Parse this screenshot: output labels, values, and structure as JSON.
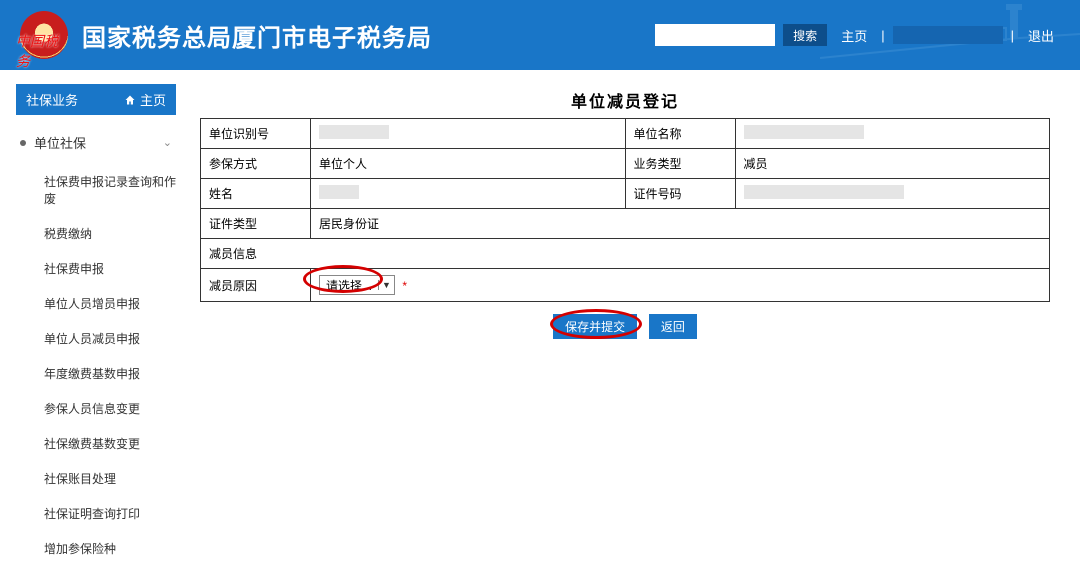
{
  "header": {
    "title": "国家税务总局厦门市电子税务局",
    "search_placeholder": "",
    "search_btn": "搜索",
    "home": "主页",
    "logout": "退出"
  },
  "sidebar": {
    "head": "社保业务",
    "home_label": "主页",
    "group": "单位社保",
    "items": [
      "社保费申报记录查询和作废",
      "税费缴纳",
      "社保费申报",
      "单位人员增员申报",
      "单位人员减员申报",
      "年度缴费基数申报",
      "参保人员信息变更",
      "社保缴费基数变更",
      "社保账目处理",
      "社保证明查询打印",
      "增加参保险种"
    ]
  },
  "form": {
    "title": "单位减员登记",
    "labels": {
      "unit_id": "单位识别号",
      "unit_name": "单位名称",
      "mode": "参保方式",
      "biz_type": "业务类型",
      "name": "姓名",
      "cert_no": "证件号码",
      "cert_type": "证件类型",
      "section": "减员信息",
      "reason": "减员原因"
    },
    "values": {
      "mode": "单位个人",
      "biz_type": "减员",
      "cert_type": "居民身份证",
      "reason_select": "请选择..."
    }
  },
  "buttons": {
    "save_submit": "保存并提交",
    "back": "返回"
  }
}
